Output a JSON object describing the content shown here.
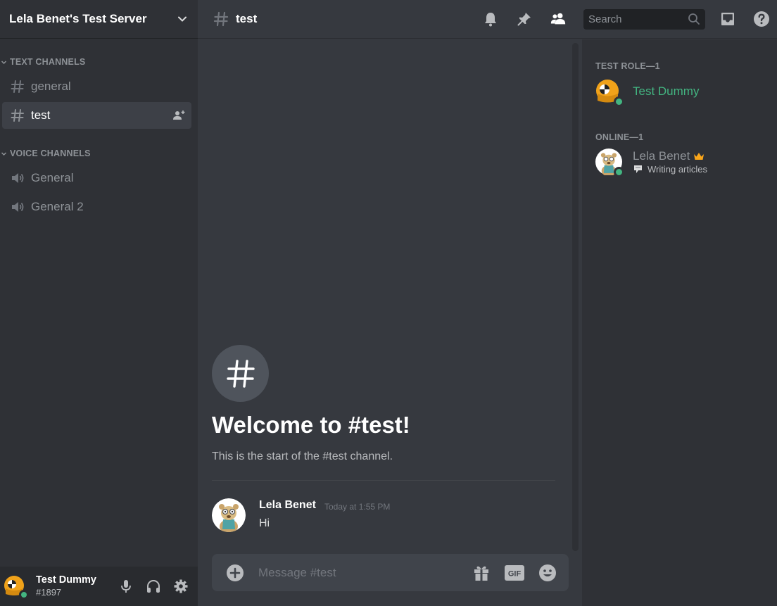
{
  "server": {
    "name": "Lela Benet's Test Server"
  },
  "categories": {
    "text": "TEXT CHANNELS",
    "voice": "VOICE CHANNELS"
  },
  "text_channels": [
    {
      "name": "general",
      "active": false
    },
    {
      "name": "test",
      "active": true
    }
  ],
  "voice_channels": [
    {
      "name": "General"
    },
    {
      "name": "General 2"
    }
  ],
  "header": {
    "channel": "test",
    "search_placeholder": "Search"
  },
  "welcome": {
    "title": "Welcome to #test!",
    "subtitle": "This is the start of the #test channel."
  },
  "messages": [
    {
      "author": "Lela Benet",
      "timestamp": "Today at 1:55 PM",
      "text": "Hi"
    }
  ],
  "composer": {
    "placeholder": "Message #test",
    "gif_label": "GIF"
  },
  "member_list": {
    "groups": [
      {
        "label": "TEST ROLE—1",
        "members": [
          {
            "name": "Test Dummy",
            "color": "#43b581"
          }
        ]
      },
      {
        "label": "ONLINE—1",
        "members": [
          {
            "name": "Lela Benet",
            "color": "#8e9297",
            "activity": "Writing articles",
            "owner": true
          }
        ]
      }
    ]
  },
  "user": {
    "name": "Test Dummy",
    "tag": "#1897",
    "status": "online"
  },
  "colors": {
    "online": "#43b581",
    "owner_crown": "#faa61a",
    "role_green": "#43b581"
  }
}
